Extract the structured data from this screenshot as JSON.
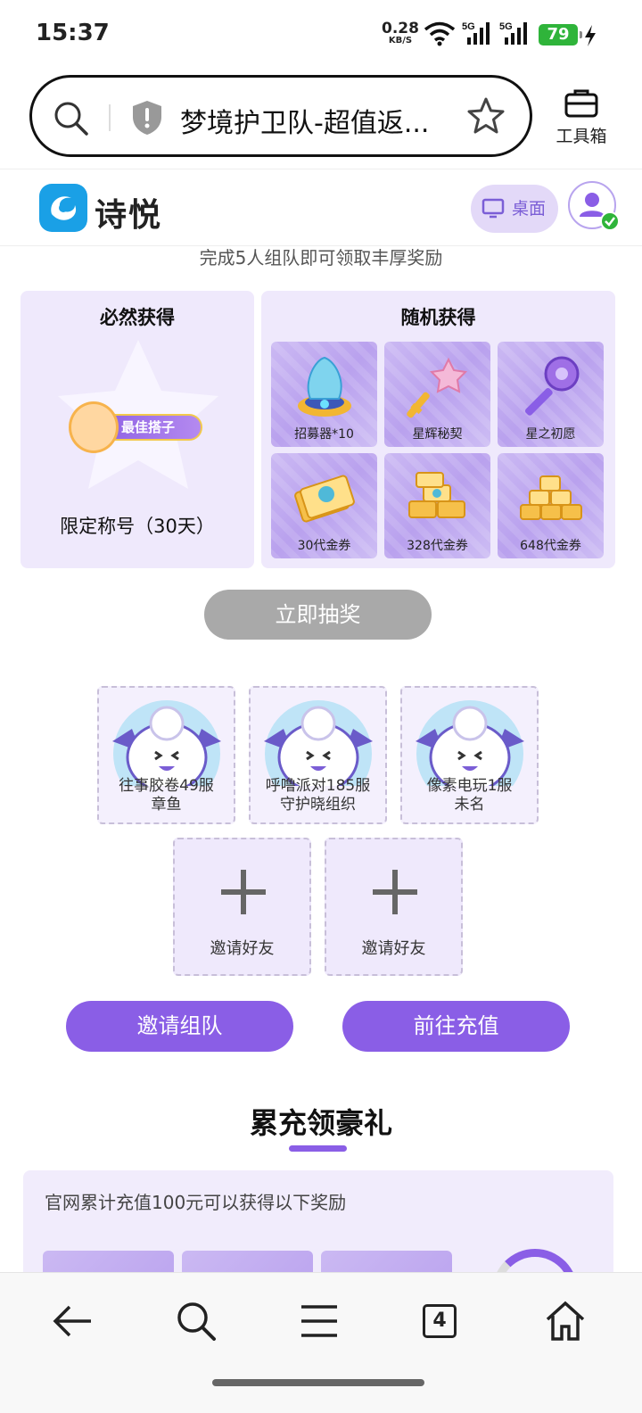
{
  "status": {
    "time": "15:37",
    "net_speed": "0.28",
    "net_unit": "KB/S",
    "battery": "79"
  },
  "browser": {
    "url_text": "梦境护卫队-超值返...",
    "toolbox_label": "工具箱",
    "tab_count": "4"
  },
  "site": {
    "logo_text": "诗悦",
    "desktop_button": "桌面"
  },
  "team": {
    "subtitle": "完成5人组队即可领取丰厚奖励",
    "guaranteed": {
      "title": "必然获得",
      "badge_text": "最佳搭子",
      "reward": "限定称号（30天）"
    },
    "random": {
      "title": "随机获得",
      "prizes": [
        "招募器*10",
        "星辉秘契",
        "星之初愿",
        "30代金券",
        "328代金券",
        "648代金券"
      ]
    },
    "draw_button": "立即抽奖",
    "members": [
      {
        "line1": "往事胶卷49服",
        "line2": "章鱼"
      },
      {
        "line1": "呼噜派对185服",
        "line2": "守护晓组织"
      },
      {
        "line1": "像素电玩1服",
        "line2": "未名"
      }
    ],
    "invite_slots": [
      "邀请好友",
      "邀请好友"
    ],
    "invite_button": "邀请组队",
    "recharge_button": "前往充值"
  },
  "cumulative": {
    "title": "累充领豪礼",
    "description": "官网累计充值100元可以获得以下奖励"
  },
  "colors": {
    "accent": "#8a5ee6",
    "card_bg": "#efe9fc",
    "disabled_button": "#a9a9a9"
  }
}
